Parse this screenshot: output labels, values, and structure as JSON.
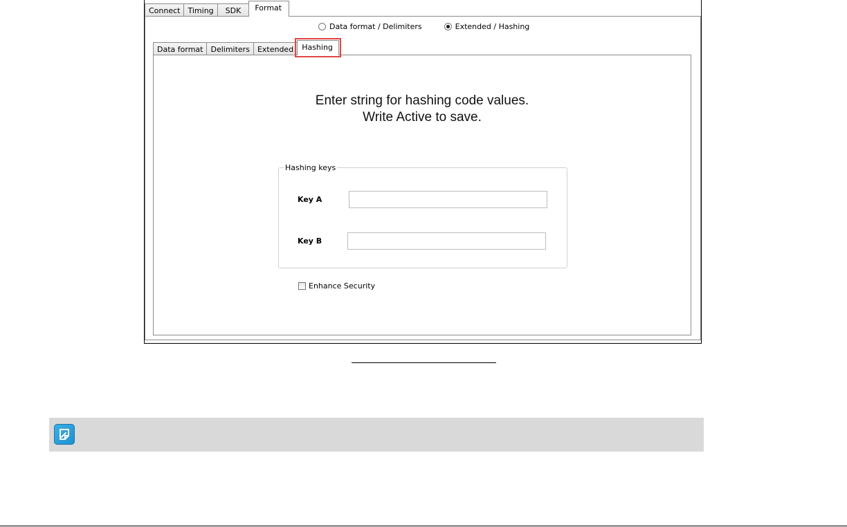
{
  "top_tabs": [
    {
      "label": "Connect",
      "active": false
    },
    {
      "label": "Timing",
      "active": false
    },
    {
      "label": "SDK",
      "active": false
    },
    {
      "label": "Format",
      "active": true
    }
  ],
  "mode_radios": [
    {
      "label": "Data format / Delimiters",
      "checked": false
    },
    {
      "label": "Extended / Hashing",
      "checked": true
    }
  ],
  "sub_tabs": [
    {
      "label": "Data format",
      "active": false
    },
    {
      "label": "Delimiters",
      "active": false
    },
    {
      "label": "Extended",
      "active": false
    },
    {
      "label": "Hashing",
      "active": true
    }
  ],
  "highlight_color": "#e04545",
  "instructions": {
    "line1": "Enter string for hashing code values.",
    "line2": "Write Active to save."
  },
  "hashing_keys": {
    "title": "Hashing keys",
    "key_a_label": "Key A",
    "key_a_value": "",
    "key_b_label": "Key B",
    "key_b_value": ""
  },
  "enhance_security": {
    "label": "Enhance Security",
    "checked": false
  },
  "note": {
    "icon": "note-pencil-icon",
    "icon_color": "#1f8fcf"
  }
}
